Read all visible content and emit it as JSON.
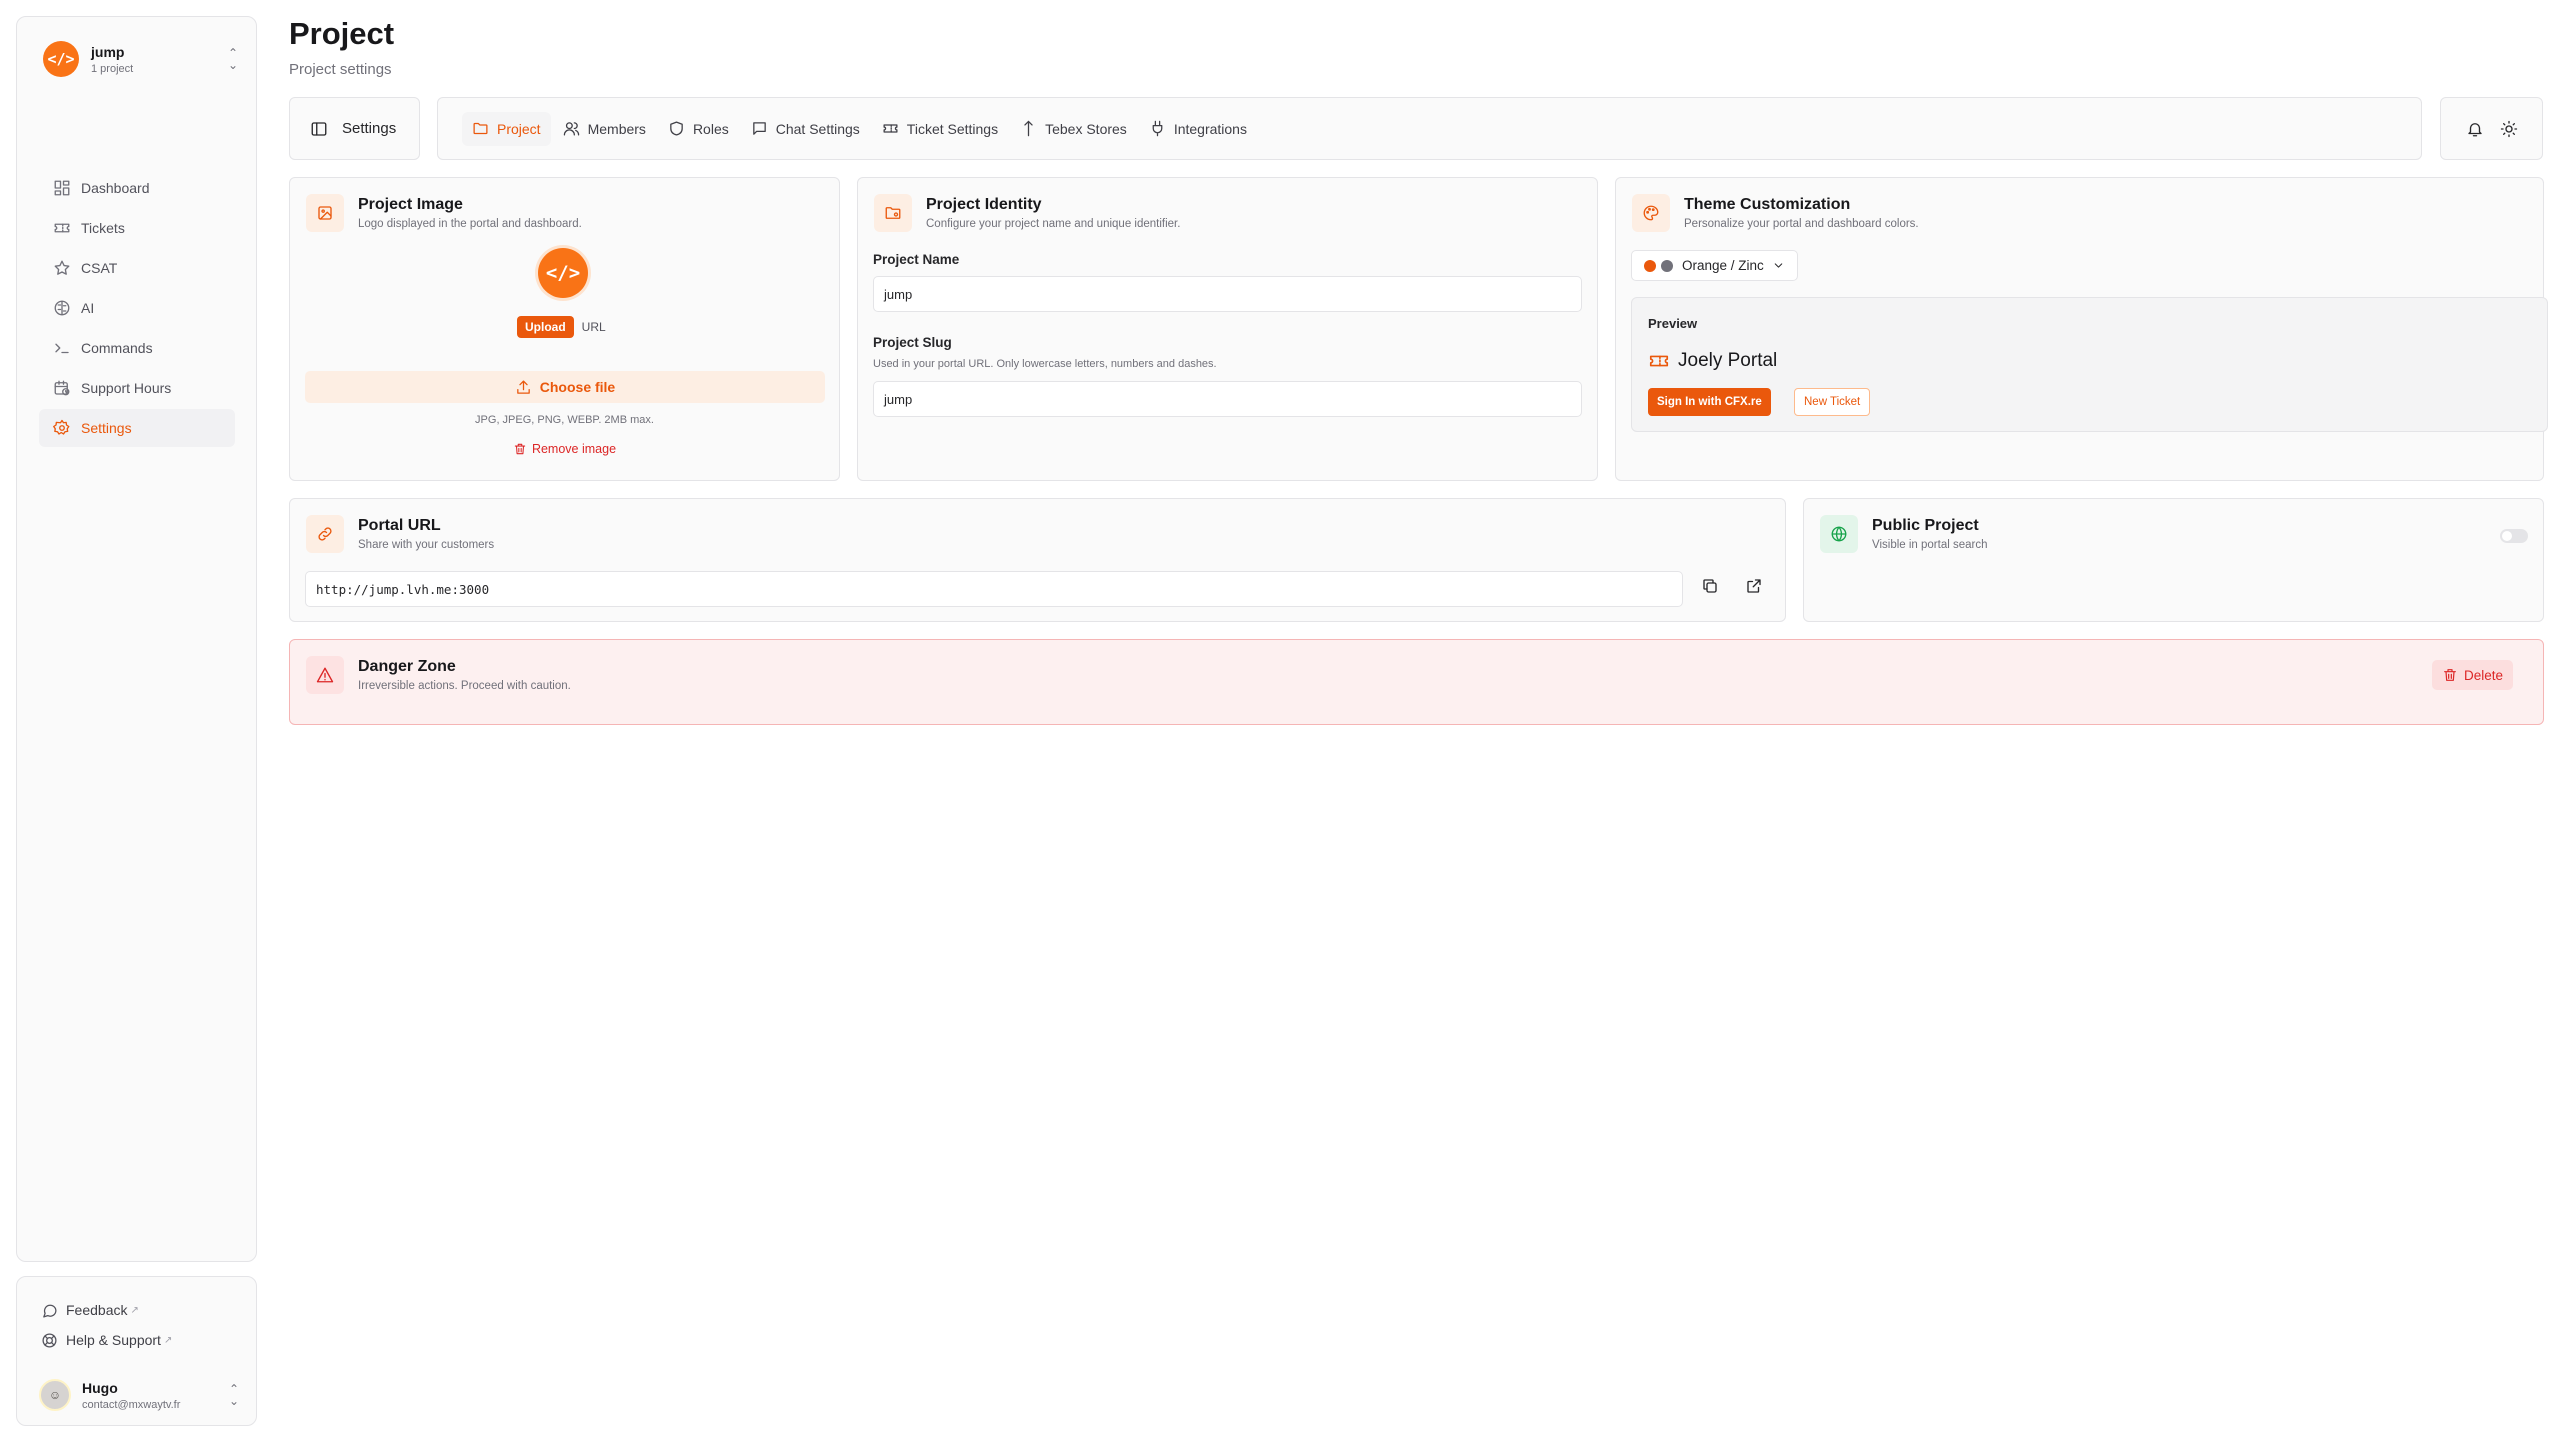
{
  "project_switcher": {
    "name": "jump",
    "count": "1 project",
    "logo": "</>"
  },
  "nav": [
    {
      "label": "Dashboard",
      "icon": "dashboard-icon"
    },
    {
      "label": "Tickets",
      "icon": "ticket-icon"
    },
    {
      "label": "CSAT",
      "icon": "star-icon"
    },
    {
      "label": "AI",
      "icon": "ai-icon"
    },
    {
      "label": "Commands",
      "icon": "terminal-icon"
    },
    {
      "label": "Support Hours",
      "icon": "calendar-clock-icon"
    },
    {
      "label": "Settings",
      "icon": "gear-icon",
      "active": true
    }
  ],
  "sidebar_footer": {
    "feedback": "Feedback",
    "help": "Help & Support",
    "external_mark": "↗",
    "user": {
      "name": "Hugo",
      "email": "contact@mxwaytv.fr"
    }
  },
  "header": {
    "title": "Project",
    "subtitle": "Project settings"
  },
  "toolbar": {
    "settings_label": "Settings",
    "tabs": [
      {
        "label": "Project",
        "active": true
      },
      {
        "label": "Members"
      },
      {
        "label": "Roles"
      },
      {
        "label": "Chat Settings"
      },
      {
        "label": "Ticket Settings"
      },
      {
        "label": "Tebex Stores"
      },
      {
        "label": "Integrations"
      }
    ]
  },
  "project_image": {
    "title": "Project Image",
    "desc": "Logo displayed in the portal and dashboard.",
    "upload_label": "Upload",
    "url_label": "URL",
    "choose_label": "Choose file",
    "formats": "JPG, JPEG, PNG, WEBP. 2MB max.",
    "remove_label": "Remove image"
  },
  "project_identity": {
    "title": "Project Identity",
    "desc": "Configure your project name and unique identifier.",
    "name_label": "Project Name",
    "name_value": "jump",
    "slug_label": "Project Slug",
    "slug_hint": "Used in your portal URL. Only lowercase letters, numbers and dashes.",
    "slug_value": "jump"
  },
  "theme": {
    "title": "Theme Customization",
    "desc": "Personalize your portal and dashboard colors.",
    "selected": "Orange / Zinc",
    "colors": {
      "primary": "#ea580c",
      "secondary": "#71717a"
    },
    "preview_label": "Preview",
    "preview_brand": "Joely Portal",
    "preview_btn_primary": "Sign In with CFX.re",
    "preview_btn_secondary": "New Ticket"
  },
  "portal_url": {
    "title": "Portal URL",
    "desc": "Share with your customers",
    "value": "http://jump.lvh.me:3000"
  },
  "public_project": {
    "title": "Public Project",
    "desc": "Visible in portal search",
    "enabled": false
  },
  "danger": {
    "title": "Danger Zone",
    "desc": "Irreversible actions. Proceed with caution.",
    "delete_label": "Delete"
  }
}
